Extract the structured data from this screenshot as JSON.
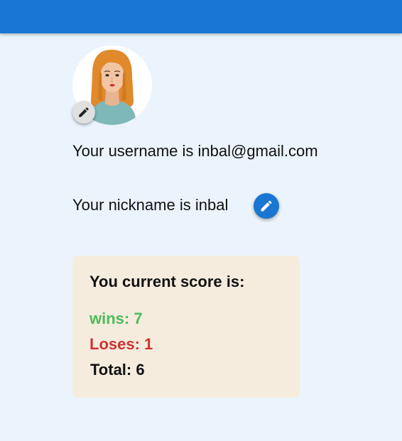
{
  "header": {
    "color": "#1976d2"
  },
  "profile": {
    "avatar_icon": "woman-avatar-icon",
    "avatar_edit_icon": "pencil-icon",
    "username_prefix": "Your username is ",
    "username": "inbal@gmail.com",
    "nickname_prefix": "Your nickname is ",
    "nickname": "inbal",
    "nickname_edit_icon": "pencil-icon"
  },
  "score": {
    "title": "You current score is:",
    "wins_label": "wins: ",
    "wins": "7",
    "loses_label": "Loses: ",
    "loses": "1",
    "total_label": "Total: ",
    "total": "6"
  },
  "colors": {
    "background": "#ebf4fc",
    "card": "#f5ecdd",
    "wins": "#4cbb5b",
    "loses": "#cc3333"
  }
}
